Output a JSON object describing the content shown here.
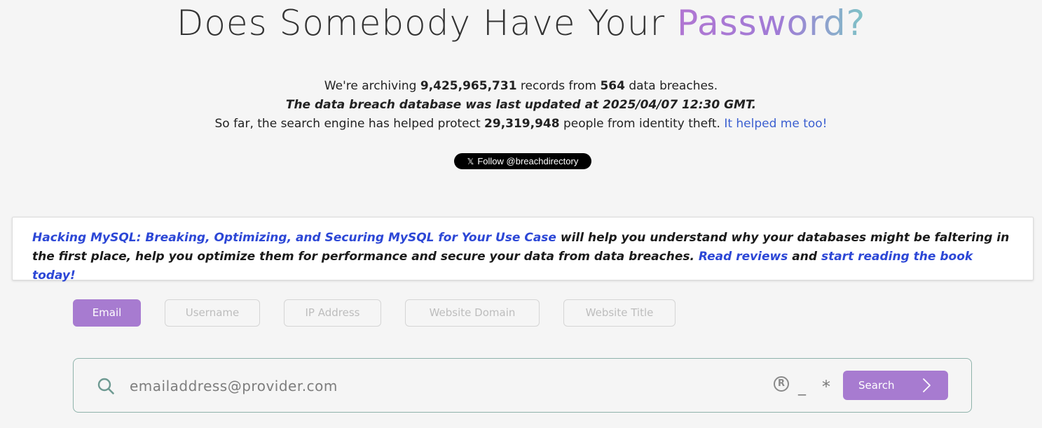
{
  "header": {
    "title_prefix": "Does Somebody Have Your ",
    "title_highlight": "Password?"
  },
  "stats": {
    "line1_pre": "We're archiving ",
    "records": "9,425,965,731",
    "line1_mid": " records from ",
    "breaches": "564",
    "line1_post": " data breaches.",
    "updated": "The data breach database was last updated at 2025/04/07 12:30 GMT.",
    "line3_pre": "So far, the search engine has helped protect ",
    "people": "29,319,948",
    "line3_post": " people from identity theft. ",
    "helped_link": "It helped me too!"
  },
  "social": {
    "icon": "x-logo-icon",
    "follow_label": "Follow @breachdirectory"
  },
  "promo": {
    "book_link": "Hacking MySQL: Breaking, Optimizing, and Securing MySQL for Your Use Case",
    "text1": " will help you understand why your databases might be faltering in the first place, help you optimize them for performance and secure your data from data breaches. ",
    "reviews_link": "Read reviews",
    "text2": " and ",
    "start_link": "start reading the book today!"
  },
  "search_types": {
    "active": "Email",
    "tabs": [
      "Email",
      "Username",
      "IP Address",
      "Website Domain",
      "Website Title"
    ]
  },
  "search": {
    "icon": "search-icon",
    "placeholder": "emailaddress@provider.com",
    "value": "",
    "modifiers": {
      "regex": "R",
      "single_char": "_",
      "wildcard": "*"
    },
    "button_label": "Search",
    "button_icon": "chevron-right-icon"
  },
  "colors": {
    "accent": "#a77bd0",
    "link": "#2c47d6",
    "search_border": "#8fb3ab",
    "background": "#f5f5f5"
  }
}
